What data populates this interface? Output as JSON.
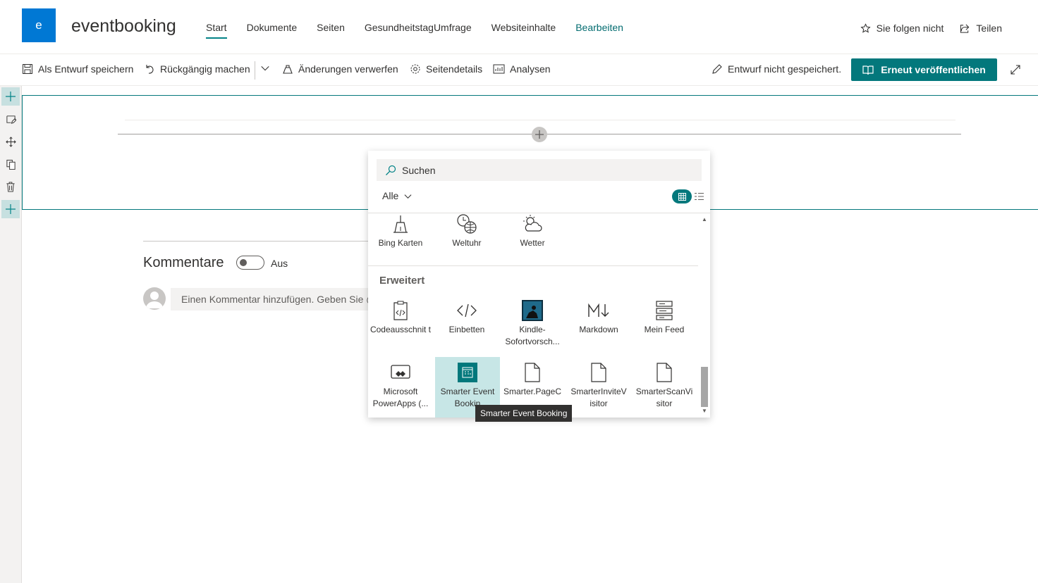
{
  "site": {
    "logo_letter": "e",
    "title": "eventbooking",
    "nav": [
      {
        "label": "Start",
        "active": true
      },
      {
        "label": "Dokumente"
      },
      {
        "label": "Seiten"
      },
      {
        "label": "GesundheitstagUmfrage"
      },
      {
        "label": "Websiteinhalte"
      },
      {
        "label": "Bearbeiten"
      }
    ],
    "follow_label": "Sie folgen nicht",
    "share_label": "Teilen"
  },
  "commandbar": {
    "save_draft": "Als Entwurf speichern",
    "undo": "Rückgängig machen",
    "discard": "Änderungen verwerfen",
    "page_details": "Seitendetails",
    "analytics": "Analysen",
    "status": "Entwurf nicht gespeichert.",
    "publish": "Erneut veröffentlichen"
  },
  "comments": {
    "title": "Kommentare",
    "toggle_label": "Aus",
    "input_placeholder": "Einen Kommentar hinzufügen. Geben Sie @"
  },
  "toolbox": {
    "search_placeholder": "Suchen",
    "filter": "Alle",
    "top_row": [
      {
        "label": "Bing Karten",
        "icon": "map-icon"
      },
      {
        "label": "Weltuhr",
        "icon": "world-clock-icon"
      },
      {
        "label": "Wetter",
        "icon": "weather-icon"
      }
    ],
    "group_title": "Erweitert",
    "advanced_row1": [
      {
        "label": "Codeausschnit t",
        "icon": "code-snippet-icon"
      },
      {
        "label": "Einbetten",
        "icon": "embed-icon"
      },
      {
        "label": "Kindle-Sofortvorsch...",
        "icon": "kindle-icon"
      },
      {
        "label": "Markdown",
        "icon": "markdown-icon"
      },
      {
        "label": "Mein Feed",
        "icon": "feed-icon"
      }
    ],
    "advanced_row2": [
      {
        "label": "Microsoft PowerApps (...",
        "icon": "powerapps-icon"
      },
      {
        "label": "Smarter Event Bookin",
        "icon": "event-booking-icon",
        "selected": true
      },
      {
        "label": "Smarter.PageC",
        "icon": "document-icon"
      },
      {
        "label": "SmarterInviteV isitor",
        "icon": "document-icon"
      },
      {
        "label": "SmarterScanVi sitor",
        "icon": "document-icon"
      }
    ]
  },
  "tooltip": "Smarter Event Booking",
  "colors": {
    "accent": "#03787c",
    "brand": "#0078d4"
  }
}
